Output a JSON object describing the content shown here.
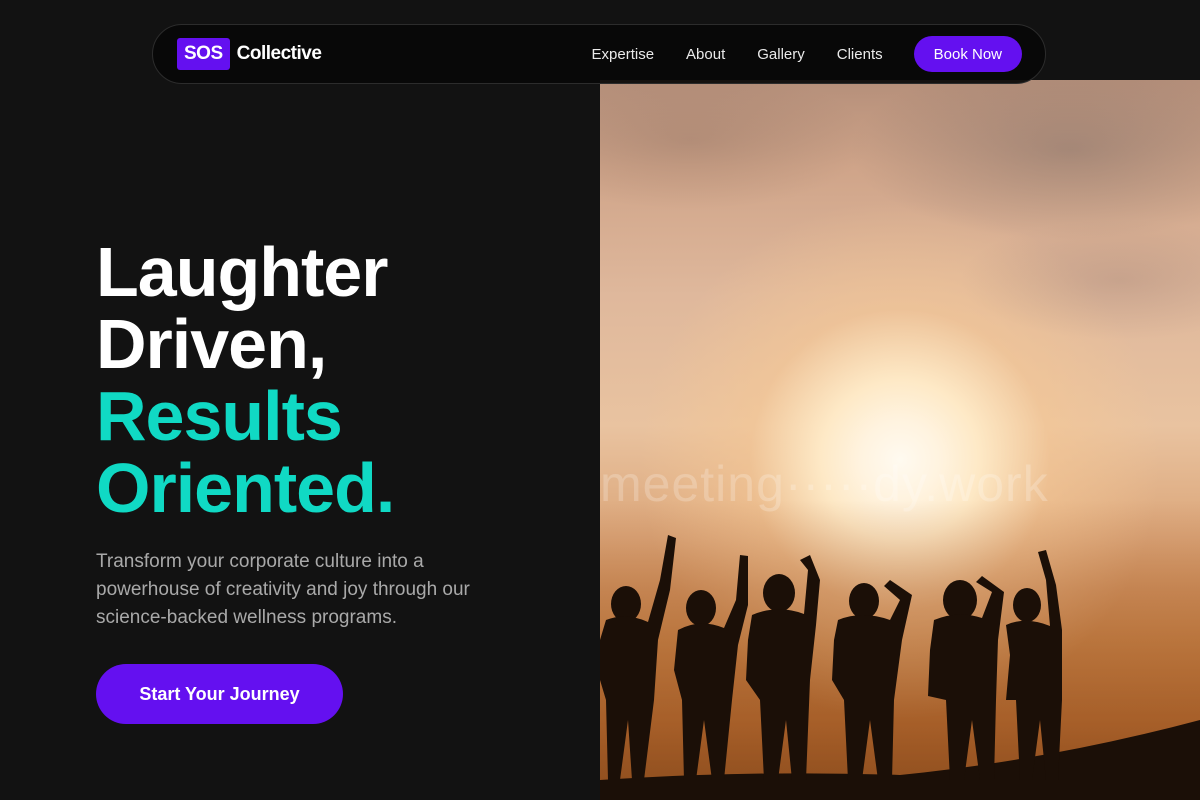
{
  "nav": {
    "logo_badge": "SOS",
    "logo_text": "Collective",
    "links": [
      "Expertise",
      "About",
      "Gallery",
      "Clients"
    ],
    "book_label": "Book Now"
  },
  "hero": {
    "headline": [
      "Laughter",
      "Driven,",
      "Results",
      "Oriented."
    ],
    "subtext": "Transform your corporate culture into a powerhouse of creativity and joy through our science-backed wellness programs.",
    "cta_label": "Start Your Journey",
    "image_watermark": "meeting·····dy.work"
  },
  "colors": {
    "background": "#121212",
    "brand_purple": "#6410f0",
    "accent_teal": "#10d9c4",
    "subtext_gray": "#a9a9a9"
  }
}
